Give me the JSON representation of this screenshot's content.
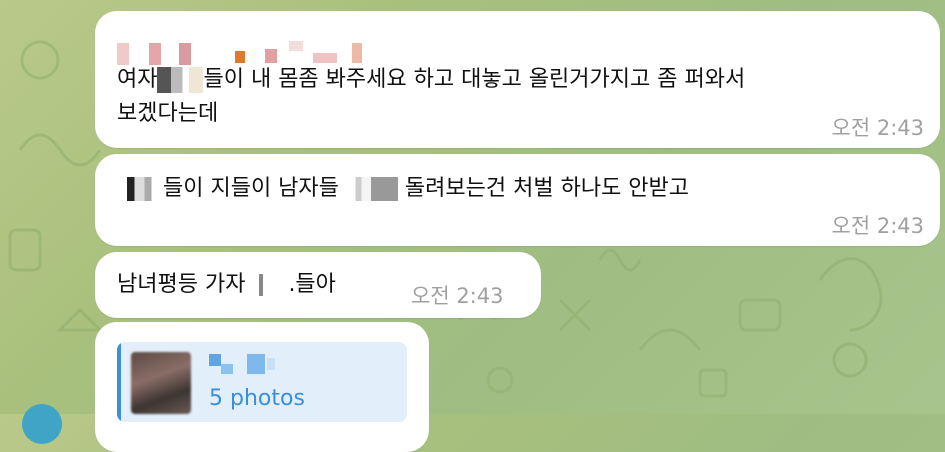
{
  "chat": {
    "messages": [
      {
        "text_a": "여자",
        "text_b": "들이 내 몸좀 봐주세요 하고 대놓고 올린거가지고 좀 퍼와서",
        "text_c": "보겠다는데",
        "time": "오전 2:43"
      },
      {
        "text_a": "들이 지들이 남자들",
        "text_b": "돌려보는건 처벌 하나도 안받고",
        "time": "오전 2:43"
      },
      {
        "text_a": "남녀평등 가자",
        "text_b": ".들아",
        "time": "오전 2:43"
      }
    ],
    "shared": {
      "label": "5 photos"
    }
  },
  "colors": {
    "bubble": "#ffffff",
    "time": "#a0a0a0",
    "link": "#3a8fd9",
    "quote_bg": "#e2effa"
  }
}
